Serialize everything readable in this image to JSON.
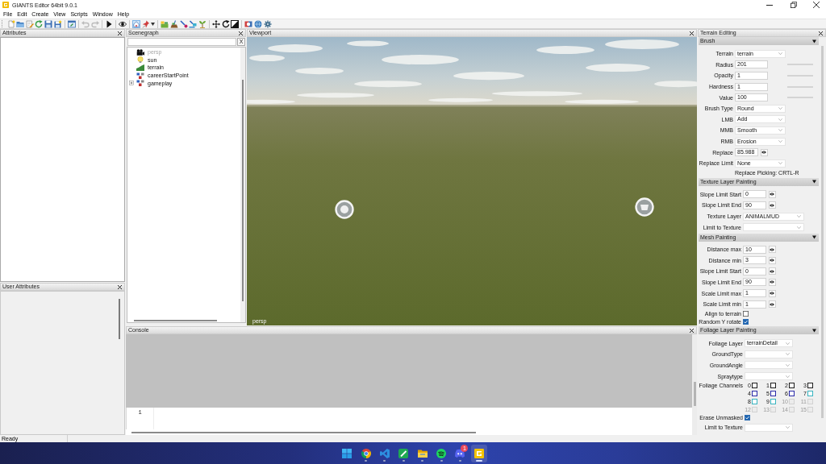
{
  "window": {
    "title": "GIANTS Editor 64bit 9.0.1"
  },
  "menu": [
    "File",
    "Edit",
    "Create",
    "View",
    "Scripts",
    "Window",
    "Help"
  ],
  "toolbar": {
    "undo": {
      "disabled": true
    },
    "redo": {
      "disabled": true
    },
    "select_tool": {
      "selected": true
    },
    "place_tool": {
      "selected": false
    }
  },
  "attributes": {
    "title": "Attributes"
  },
  "user_attributes": {
    "title": "User Attributes"
  },
  "scenegraph": {
    "title": "Scenegraph",
    "clear_button": "X",
    "items": [
      {
        "label": "persp",
        "kind": "camera",
        "visible": false,
        "collapsed": false
      },
      {
        "label": "sun",
        "kind": "light",
        "visible": true,
        "collapsed": false
      },
      {
        "label": "terrain",
        "kind": "terrain",
        "visible": true,
        "collapsed": false
      },
      {
        "label": "careerStartPoint",
        "kind": "group",
        "visible": true,
        "collapsed": false
      },
      {
        "label": "gameplay",
        "kind": "group",
        "visible": true,
        "collapsed": true
      }
    ]
  },
  "viewport": {
    "title": "Viewport",
    "camera": "persp"
  },
  "console": {
    "title": "Console",
    "line_numbers": [
      "1"
    ]
  },
  "terrain_editing": {
    "title": "Terrain Editing",
    "sections": [
      {
        "title": "Brush",
        "expanded": true,
        "rows": [
          {
            "kind": "dropdown",
            "label": "Terrain",
            "value": "terrain"
          },
          {
            "kind": "slider",
            "label": "Radius",
            "value": "201"
          },
          {
            "kind": "slider",
            "label": "Opacity",
            "value": "1"
          },
          {
            "kind": "slider",
            "label": "Hardness",
            "value": "1"
          },
          {
            "kind": "slider",
            "label": "Value",
            "value": "100"
          },
          {
            "kind": "dropdown",
            "label": "Brush Type",
            "value": "Round"
          },
          {
            "kind": "dropdown",
            "label": "LMB",
            "value": "Add"
          },
          {
            "kind": "dropdown",
            "label": "MMB",
            "value": "Smooth"
          },
          {
            "kind": "dropdown",
            "label": "RMB",
            "value": "Erosion"
          },
          {
            "kind": "spin",
            "label": "Replace",
            "value": "85.988"
          },
          {
            "kind": "dropdown",
            "label": "Replace Limit",
            "value": "None"
          },
          {
            "kind": "note",
            "text": "Replace Picking: CRTL-R"
          }
        ]
      },
      {
        "title": "Texture Layer Painting",
        "expanded": true,
        "rows": [
          {
            "kind": "spin",
            "label": "Slope Limit Start",
            "value": "0"
          },
          {
            "kind": "spin",
            "label": "Slope Limit End",
            "value": "90"
          },
          {
            "kind": "dropdown",
            "label": "Texture Layer",
            "value": "ANIMALMUD"
          },
          {
            "kind": "dropdown",
            "label": "Limit to Texture"
          }
        ]
      },
      {
        "title": "Mesh Painting",
        "expanded": true,
        "rows": [
          {
            "kind": "spin",
            "label": "Distance max",
            "value": "10"
          },
          {
            "kind": "spin",
            "label": "Distance min",
            "value": "3"
          },
          {
            "kind": "spin",
            "label": "Slope Limit Start",
            "value": "0"
          },
          {
            "kind": "spin",
            "label": "Slope Limit End",
            "value": "90"
          },
          {
            "kind": "spin",
            "label": "Scale Limit max",
            "value": "1"
          },
          {
            "kind": "spin",
            "label": "Scale Limit min",
            "value": "1"
          },
          {
            "kind": "checkbox",
            "label": "Align to terrain",
            "checked": false
          },
          {
            "kind": "checkbox",
            "label": "Random Y rotate",
            "checked": true
          }
        ]
      },
      {
        "title": "Foliage Layer Painting",
        "expanded": true,
        "rows": [
          {
            "kind": "dropdown",
            "label": "Foliage Layer",
            "value": "terrainDetail"
          },
          {
            "kind": "dropdown",
            "label": "GroundType"
          },
          {
            "kind": "dropdown",
            "label": "GroundAngle"
          },
          {
            "kind": "dropdown",
            "label": "Spraytype"
          },
          {
            "kind": "channels",
            "label": "Foliage Channels",
            "channels": [
              {
                "label": "0",
                "color": "#1e1e1e",
                "checked": false,
                "disabled": false
              },
              {
                "label": "1",
                "color": "#1e1e1e",
                "checked": false,
                "disabled": false
              },
              {
                "label": "2",
                "color": "#1e1e1e",
                "checked": false,
                "disabled": false
              },
              {
                "label": "3",
                "color": "#1e1e1e",
                "checked": false,
                "disabled": false
              },
              {
                "label": "4",
                "color": "#2a2aa8",
                "checked": false,
                "disabled": false
              },
              {
                "label": "5",
                "color": "#2a2aa8",
                "checked": false,
                "disabled": false
              },
              {
                "label": "6",
                "color": "#2a2aa8",
                "checked": false,
                "disabled": false
              },
              {
                "label": "7",
                "color": "#38b4c0",
                "checked": false,
                "disabled": false
              },
              {
                "label": "8",
                "color": "#38b4c0",
                "checked": false,
                "disabled": false
              },
              {
                "label": "9",
                "color": "#38b4c0",
                "checked": false,
                "disabled": false
              },
              {
                "label": "10",
                "color": "#d2d2d2",
                "checked": false,
                "disabled": true
              },
              {
                "label": "11",
                "color": "#d2d2d2",
                "checked": false,
                "disabled": true
              },
              {
                "label": "12",
                "color": "#d2d2d2",
                "checked": false,
                "disabled": true
              },
              {
                "label": "13",
                "color": "#d2d2d2",
                "checked": false,
                "disabled": true
              },
              {
                "label": "14",
                "color": "#d2d2d2",
                "checked": false,
                "disabled": true
              },
              {
                "label": "15",
                "color": "#d2d2d2",
                "checked": false,
                "disabled": true
              }
            ]
          },
          {
            "kind": "checkbox",
            "label": "Erase Unmasked",
            "checked": true
          },
          {
            "kind": "dropdown",
            "label": "Limit to Texture"
          }
        ]
      }
    ]
  },
  "status_bar": {
    "text": "Ready"
  },
  "taskbar": {
    "apps": [
      {
        "running": false,
        "active": false
      },
      {
        "running": true,
        "active": false
      },
      {
        "running": true,
        "active": false
      },
      {
        "running": true,
        "active": false
      },
      {
        "running": true,
        "active": false
      },
      {
        "running": true,
        "active": false
      },
      {
        "running": true,
        "active": false,
        "badge": "1"
      },
      {
        "running": true,
        "active": true
      }
    ]
  }
}
